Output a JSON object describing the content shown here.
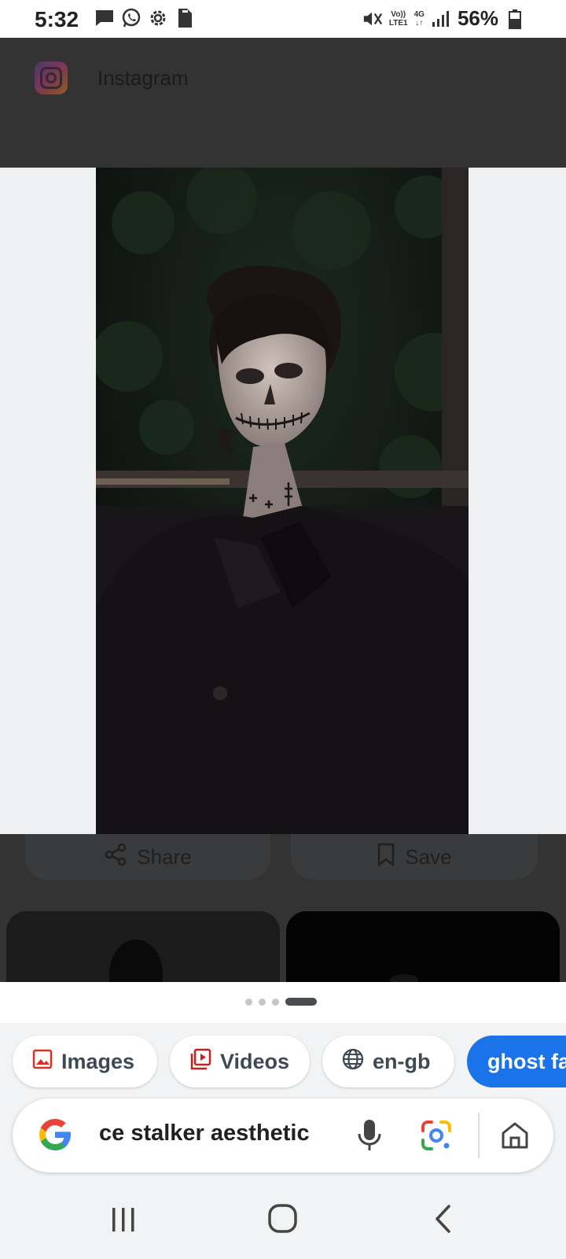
{
  "status_bar": {
    "time": "5:32",
    "battery_percent": "56%",
    "left_icons": [
      "message-icon",
      "whatsapp-icon",
      "settings-icon",
      "sim-card-icon"
    ],
    "right_icons": [
      "mute-icon",
      "volte-icon",
      "4g-icon",
      "signal-icon",
      "battery-icon"
    ],
    "volte_top": "Vo))",
    "volte_bottom": "LTE1",
    "net_type": "4G"
  },
  "source": {
    "name": "Instagram",
    "logo_icon": "instagram-logo"
  },
  "actions": {
    "share_label": "Share",
    "save_label": "Save"
  },
  "pager": {
    "count": 4,
    "active_index": 3
  },
  "chips": {
    "images_label": "Images",
    "videos_label": "Videos",
    "language_label": "en-gb",
    "query_label": "ghost fa"
  },
  "search": {
    "query_text": "ce stalker aesthetic"
  },
  "colors": {
    "overlay": "#333333",
    "accent_blue": "#1a73e8",
    "chip_text": "#3d4a56",
    "images_icon": "#d93025",
    "videos_icon": "#c5221f"
  },
  "nav": {
    "buttons": [
      "recents-icon",
      "home-icon",
      "back-icon"
    ]
  }
}
